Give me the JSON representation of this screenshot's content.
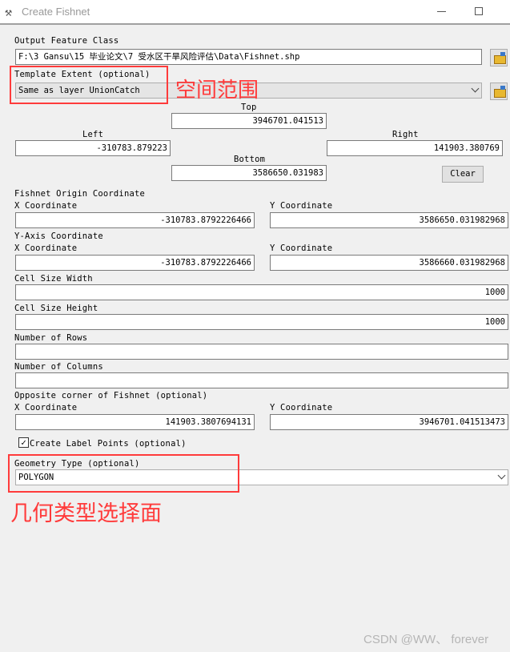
{
  "window": {
    "title": "Create Fishnet",
    "icon": "hammer-icon"
  },
  "output": {
    "label": "Output Feature Class",
    "value": "F:\\3 Gansu\\15 毕业论文\\7 受水区干旱风险评估\\Data\\Fishnet.shp"
  },
  "template": {
    "label": "Template Extent (optional)",
    "value": "Same as layer UnionCatch"
  },
  "extent": {
    "top_label": "Top",
    "top": "3946701.041513",
    "left_label": "Left",
    "left": "-310783.879223",
    "right_label": "Right",
    "right": "141903.380769",
    "bottom_label": "Bottom",
    "bottom": "3586650.031983",
    "clear": "Clear"
  },
  "origin": {
    "label": "Fishnet Origin Coordinate",
    "x_label": "X Coordinate",
    "x": "-310783.8792226466",
    "y_label": "Y Coordinate",
    "y": "3586650.031982968"
  },
  "yaxis": {
    "label": "Y-Axis Coordinate",
    "x_label": "X Coordinate",
    "x": "-310783.8792226466",
    "y_label": "Y Coordinate",
    "y": "3586660.031982968"
  },
  "cell_width": {
    "label": "Cell Size Width",
    "value": "1000"
  },
  "cell_height": {
    "label": "Cell Size Height",
    "value": "1000"
  },
  "rows": {
    "label": "Number of Rows",
    "value": ""
  },
  "columns": {
    "label": "Number of Columns",
    "value": ""
  },
  "opposite": {
    "label": "Opposite corner of Fishnet (optional)",
    "x_label": "X Coordinate",
    "x": "141903.3807694131",
    "y_label": "Y Coordinate",
    "y": "3946701.041513473"
  },
  "label_points": {
    "label": "Create Label Points (optional)",
    "checked": true
  },
  "geometry": {
    "label": "Geometry Type (optional)",
    "value": "POLYGON"
  },
  "annotations": {
    "extent_note": "空间范围",
    "geometry_note": "几何类型选择面",
    "color": "#ff3b3b"
  },
  "watermark": "CSDN @WW、 forever"
}
